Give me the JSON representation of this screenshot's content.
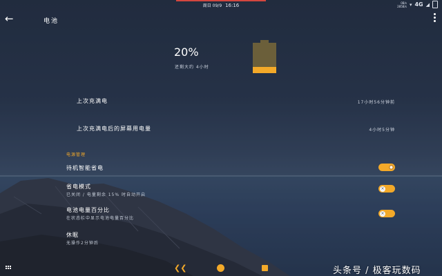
{
  "status_bar": {
    "carrier_date": "周日 09/9",
    "time": "16:16",
    "network_speed": "0B/s",
    "network_speed_2": "285B/s",
    "network_type": "4G",
    "signal_label": "4G"
  },
  "app_bar": {
    "title": "电池"
  },
  "battery": {
    "percent_text": "20%",
    "percent_value": 20,
    "remaining": "还剩大约 4小时",
    "fill_color": "#f3a929"
  },
  "rows": {
    "last_full_charge": {
      "label": "上次充满电",
      "value": "17小时56分钟前"
    },
    "screen_usage": {
      "label": "上次充满电后的屏幕用电量",
      "value": "4小时5分钟"
    }
  },
  "section_power": "电源管理",
  "settings": {
    "standby_smart_save": {
      "label": "待机智能省电",
      "enabled": true
    },
    "power_saving_mode": {
      "label": "省电模式",
      "sub": "已关闭 / 电量剩余 15% 时自动开启",
      "enabled": false
    },
    "battery_percentage": {
      "label": "电池电量百分比",
      "sub": "在状态栏中显示电池电量百分比",
      "enabled": false
    },
    "sleep": {
      "label": "休眠",
      "sub": "无操作2分钟后"
    }
  },
  "watermark": "头条号 / 极客玩数码",
  "colors": {
    "accent": "#f3a929",
    "status_red": "#d4473f"
  }
}
